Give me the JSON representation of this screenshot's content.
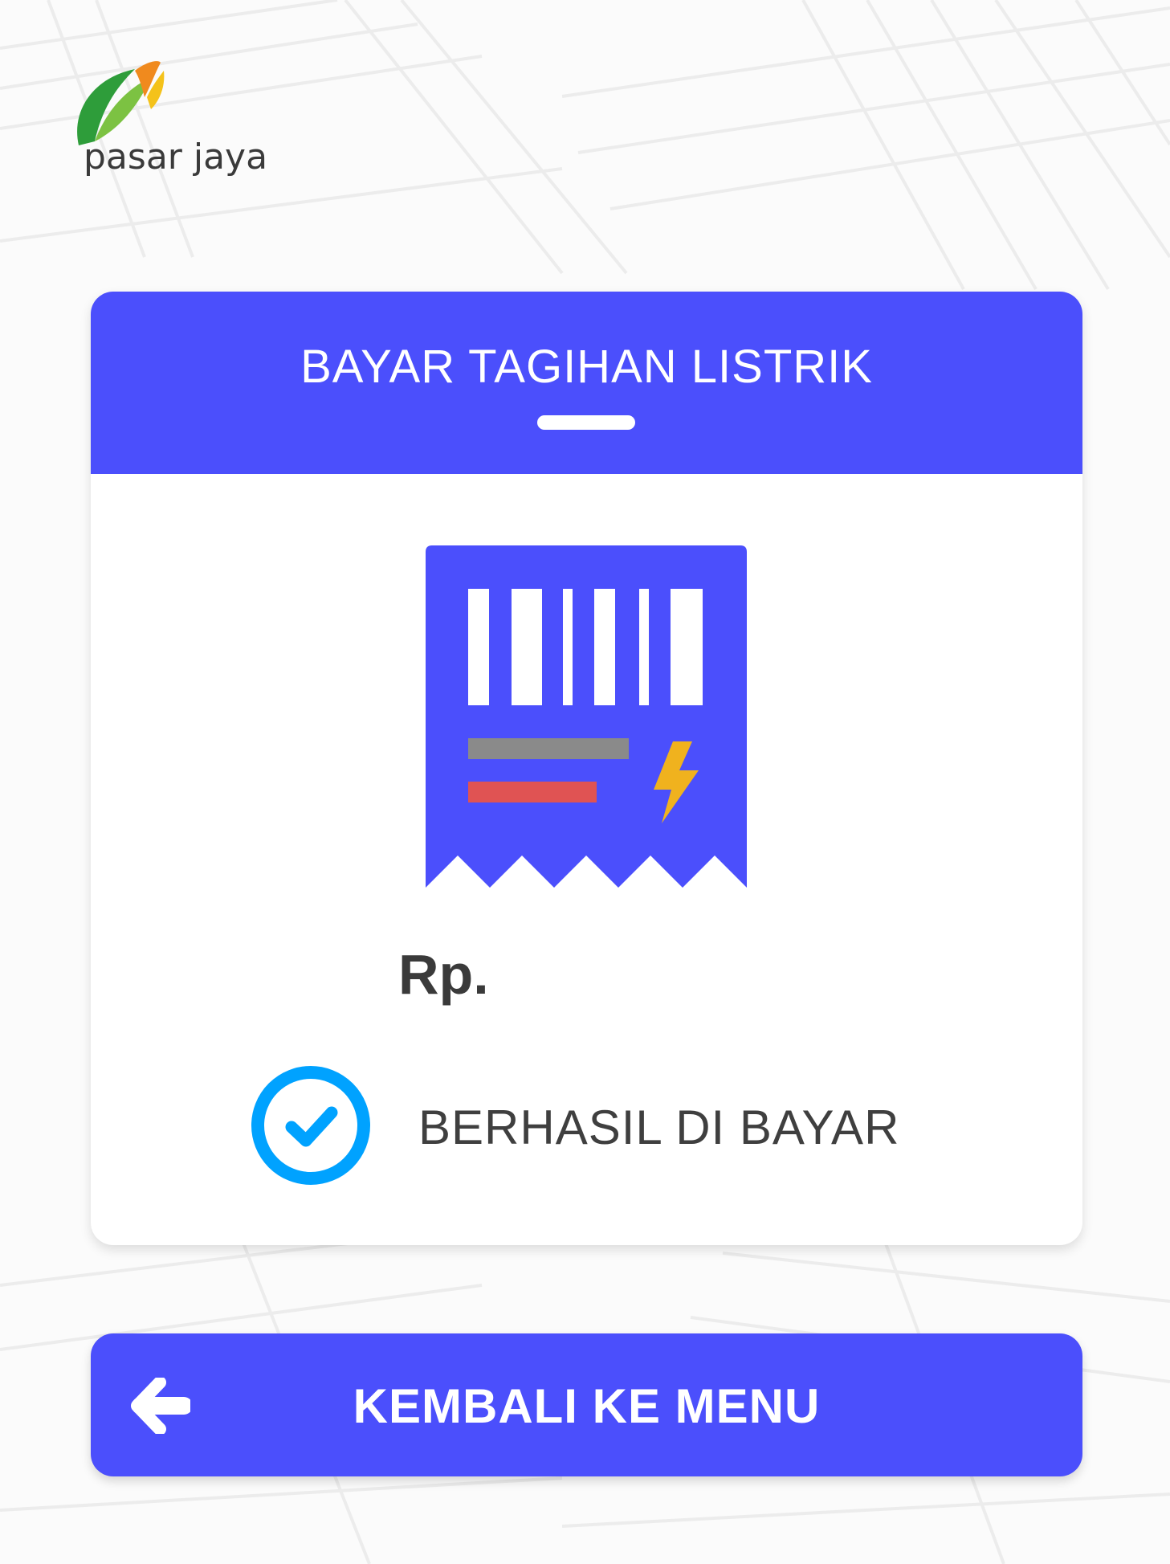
{
  "brand": {
    "logo_text": "pasar jaya"
  },
  "card": {
    "title": "BAYAR TAGIHAN LISTRIK",
    "amount_label": "Rp.",
    "status_text": "BERHASIL DI BAYAR",
    "receipt_icon": "electricity-receipt-icon",
    "status_icon": "check-circle-icon"
  },
  "actions": {
    "back_label": "KEMBALI KE MENU",
    "back_icon": "arrow-left-icon"
  },
  "colors": {
    "primary": "#4b4ffc",
    "success": "#00a2ff",
    "text_dark": "#3a3a3a",
    "bolt": "#f0b21e",
    "bar_gray": "#8a8a8a",
    "bar_red": "#e05353"
  }
}
